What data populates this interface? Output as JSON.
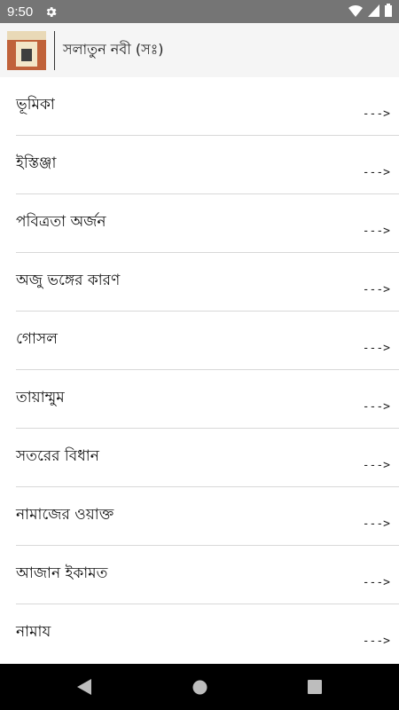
{
  "status_bar": {
    "time": "9:50",
    "icons": [
      "gear-icon",
      "wifi-icon",
      "signal-icon",
      "battery-icon"
    ]
  },
  "app_bar": {
    "title": "সলাতুন নবী (সঃ)"
  },
  "list": {
    "items": [
      {
        "label": "ভূমিকা",
        "arrow": "--->"
      },
      {
        "label": "ইস্তিঞ্জা",
        "arrow": "--->"
      },
      {
        "label": "পবিত্রতা অর্জন",
        "arrow": "--->"
      },
      {
        "label": "অজু ভঙ্গের কারণ",
        "arrow": "--->"
      },
      {
        "label": "গোসল",
        "arrow": "--->"
      },
      {
        "label": "তায়াম্মুম",
        "arrow": "--->"
      },
      {
        "label": "সতরের বিধান",
        "arrow": "--->"
      },
      {
        "label": "নামাজের ওয়াক্ত",
        "arrow": "--->"
      },
      {
        "label": "আজান ইকামত",
        "arrow": "--->"
      },
      {
        "label": "নামায",
        "arrow": "--->"
      }
    ]
  },
  "nav_bar": {
    "icons": [
      "back-icon",
      "home-icon",
      "recents-icon"
    ]
  },
  "colors": {
    "status_bar": "#757575",
    "app_bar": "#f5f5f5",
    "separator": "#d8d8d8",
    "nav_bar": "#000000"
  }
}
